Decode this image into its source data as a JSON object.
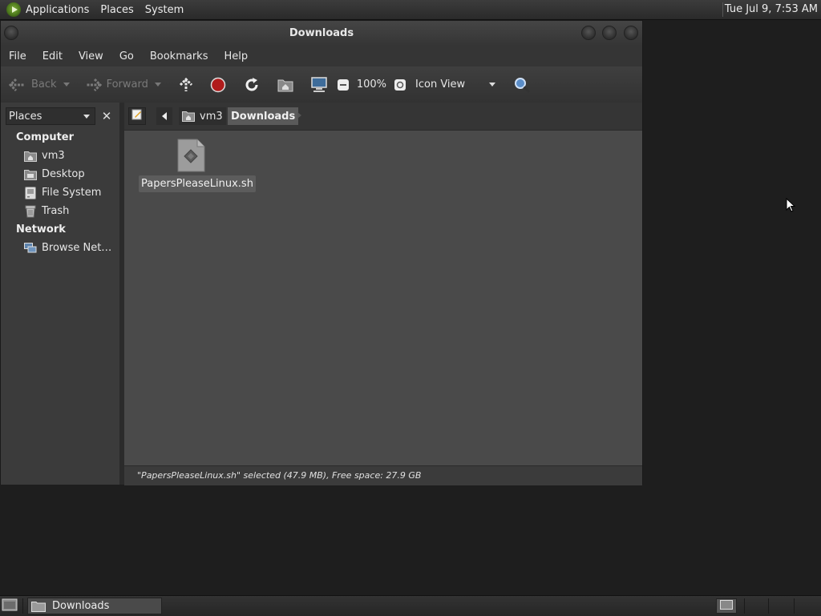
{
  "top_panel": {
    "menus": [
      "Applications",
      "Places",
      "System"
    ],
    "clock": "Tue Jul  9,  7:53 AM"
  },
  "window": {
    "title": "Downloads",
    "menubar": [
      "File",
      "Edit",
      "View",
      "Go",
      "Bookmarks",
      "Help"
    ],
    "toolbar": {
      "back_label": "Back",
      "forward_label": "Forward",
      "zoom": "100%",
      "view_mode": "Icon View"
    },
    "sidebar": {
      "selector": "Places",
      "sections": [
        {
          "heading": "Computer",
          "items": [
            {
              "label": "vm3",
              "icon": "home-folder-icon"
            },
            {
              "label": "Desktop",
              "icon": "desktop-folder-icon"
            },
            {
              "label": "File System",
              "icon": "drive-icon"
            },
            {
              "label": "Trash",
              "icon": "trash-icon"
            }
          ]
        },
        {
          "heading": "Network",
          "items": [
            {
              "label": "Browse Net…",
              "icon": "network-icon"
            }
          ]
        }
      ]
    },
    "location": {
      "crumbs": [
        "vm3",
        "Downloads"
      ]
    },
    "files": [
      {
        "name": "PapersPleaseLinux.sh",
        "icon": "script-file-icon",
        "selected": true
      }
    ],
    "status": "\"PapersPleaseLinux.sh\" selected (47.9 MB), Free space: 27.9 GB"
  },
  "bottom_panel": {
    "task_label": "Downloads"
  },
  "colors": {
    "window_bg": "#3a3a3a",
    "icon_view_bg": "#4a4a4a",
    "desktop_bg": "#1e1e1e",
    "stop_red": "#b01c1c",
    "apps_green": "#5c8a26"
  }
}
